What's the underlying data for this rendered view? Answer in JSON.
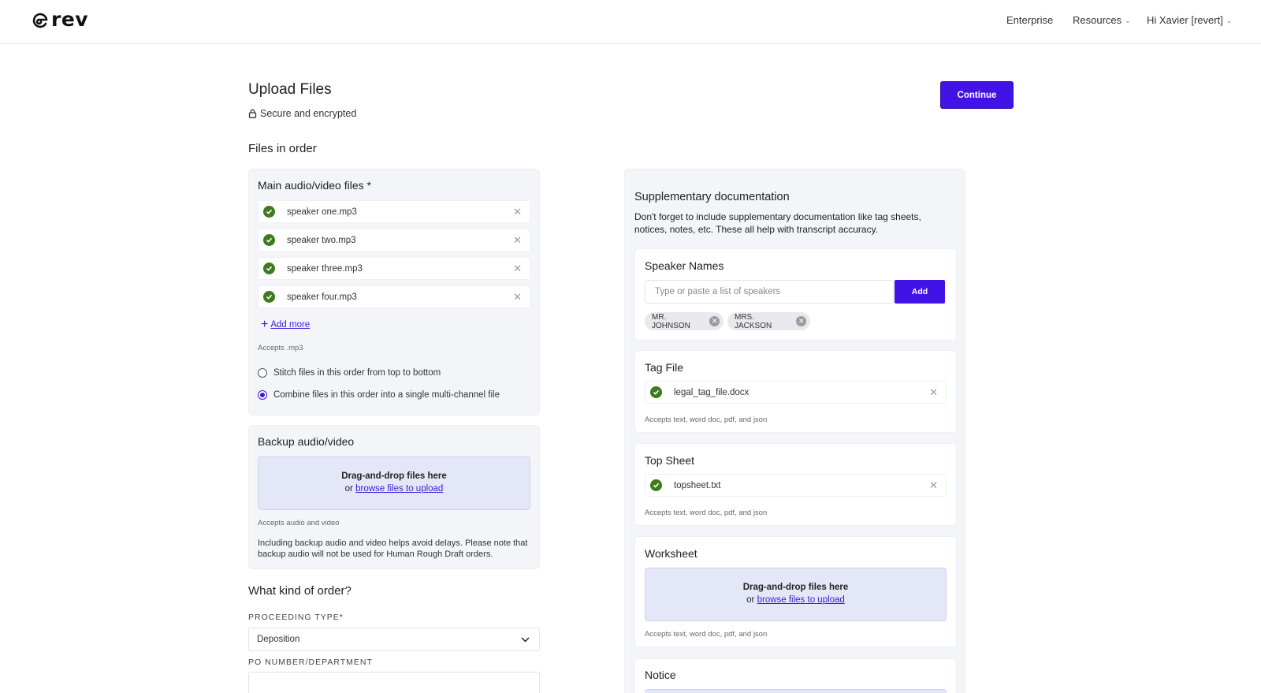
{
  "colors": {
    "accent": "#4213e6",
    "success": "#3f7a1f",
    "panel_bg": "#f4f5f9",
    "dropzone_bg": "#e4e7f7"
  },
  "header": {
    "brand": "rev",
    "nav": {
      "enterprise": "Enterprise",
      "resources": "Resources",
      "user": "Hi Xavier [revert]"
    }
  },
  "page": {
    "title": "Upload Files",
    "secure_text": "Secure and encrypted",
    "continue_label": "Continue",
    "files_section_title": "Files in order"
  },
  "main_files": {
    "title": "Main audio/video files *",
    "files": [
      "speaker one.mp3",
      "speaker two.mp3",
      "speaker three.mp3",
      "speaker four.mp3"
    ],
    "add_more": "Add more",
    "accepts": "Accepts .mp3",
    "options": [
      {
        "label": "Stitch files in this order from top to bottom",
        "selected": false
      },
      {
        "label": "Combine files in this order into a single multi-channel file",
        "selected": true
      }
    ]
  },
  "backup": {
    "title": "Backup audio/video",
    "dropzone_line1": "Drag-and-drop files here",
    "dropzone_or": "or",
    "dropzone_link": "browse files to upload",
    "accepts": "Accepts audio and video",
    "note_line1": "Including backup audio and video helps avoid delays. Please note that",
    "note_line2": "backup audio will not be used for Human Rough Draft orders."
  },
  "order": {
    "title": "What kind of order?",
    "proceeding_label": "PROCEEDING TYPE*",
    "proceeding_value": "Deposition",
    "po_label": "PO NUMBER/DEPARTMENT",
    "po_value": ""
  },
  "supplementary": {
    "title": "Supplementary documentation",
    "desc_line1": "Don't forget to include supplementary documentation like tag sheets,",
    "desc_line2": "notices, notes, etc. These all help with transcript accuracy.",
    "speaker_names": {
      "title": "Speaker Names",
      "placeholder": "Type or paste a list of speakers",
      "add_label": "Add",
      "chips": [
        "MR. JOHNSON",
        "MRS. JACKSON"
      ]
    },
    "tag_file": {
      "title": "Tag File",
      "file": "legal_tag_file.docx",
      "accepts": "Accepts text, word doc, pdf, and json"
    },
    "top_sheet": {
      "title": "Top Sheet",
      "file": "topsheet.txt",
      "accepts": "Accepts text, word doc, pdf, and json"
    },
    "worksheet": {
      "title": "Worksheet",
      "dropzone_line1": "Drag-and-drop files here",
      "dropzone_or": "or",
      "dropzone_link": "browse files to upload",
      "accepts": "Accepts text, word doc, pdf, and json"
    },
    "notice": {
      "title": "Notice"
    }
  }
}
